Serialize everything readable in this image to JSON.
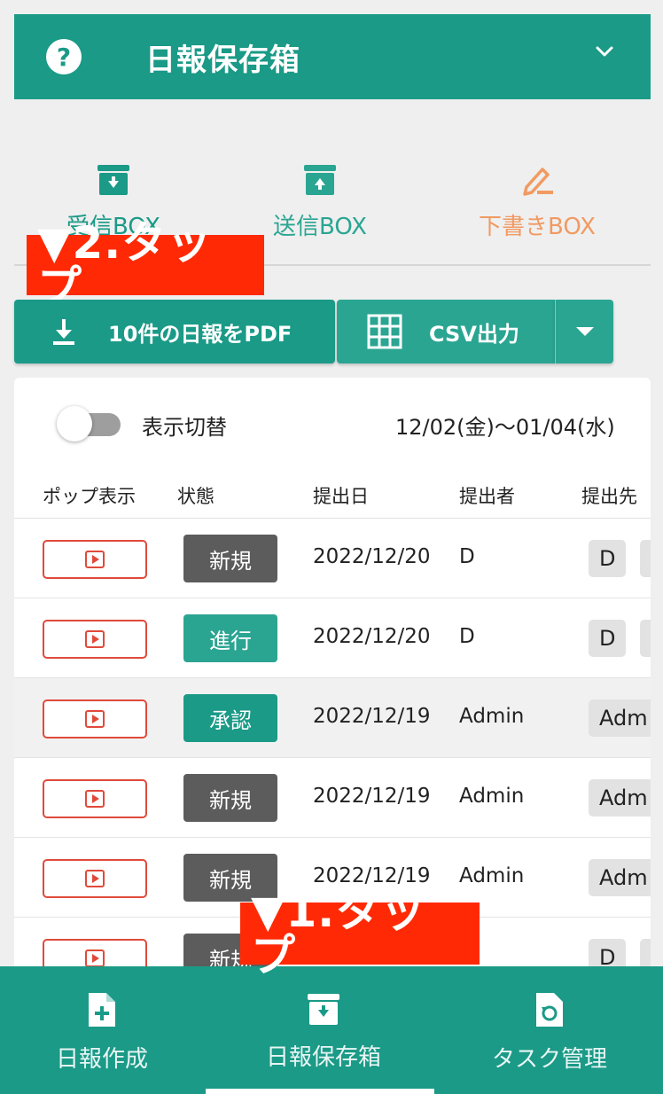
{
  "header": {
    "title": "日報保存箱",
    "help_icon": "question-circle-icon",
    "chevron_icon": "chevron-down-icon"
  },
  "box_tabs": [
    {
      "label": "受信BOX",
      "icon": "inbox-download-icon",
      "color": "#1a9a87"
    },
    {
      "label": "送信BOX",
      "icon": "inbox-upload-icon",
      "color": "#2aa592"
    },
    {
      "label": "下書きBOX",
      "icon": "pencil-icon",
      "color": "#f19a62"
    }
  ],
  "annotations": {
    "step2": "▼2.タップ",
    "step1": "▼1.タップ"
  },
  "actions": {
    "pdf_label": "10件の日報をPDF",
    "csv_label": "CSV出力"
  },
  "filter": {
    "toggle_label": "表示切替",
    "date_range": "12/02(金)〜01/04(水)"
  },
  "columns": [
    "ポップ表示",
    "状態",
    "提出日",
    "提出者",
    "提出先"
  ],
  "rows": [
    {
      "status": "新規",
      "status_color": "#5c5c5c",
      "date": "2022/12/20",
      "submitter": "D",
      "recipient": "D"
    },
    {
      "status": "進行",
      "status_color": "#2aa592",
      "date": "2022/12/20",
      "submitter": "D",
      "recipient": "D"
    },
    {
      "status": "承認",
      "status_color": "#1a9a87",
      "date": "2022/12/19",
      "submitter": "Admin",
      "recipient": "Adm"
    },
    {
      "status": "新規",
      "status_color": "#5c5c5c",
      "date": "2022/12/19",
      "submitter": "Admin",
      "recipient": "Adm"
    },
    {
      "status": "新規",
      "status_color": "#5c5c5c",
      "date": "2022/12/19",
      "submitter": "Admin",
      "recipient": "Adm"
    },
    {
      "status": "新規",
      "status_color": "#5c5c5c",
      "date": "",
      "submitter": "",
      "recipient": "D"
    }
  ],
  "bottom_nav": [
    {
      "label": "日報作成",
      "icon": "file-plus-icon"
    },
    {
      "label": "日報保存箱",
      "icon": "archive-box-icon",
      "active": true
    },
    {
      "label": "タスク管理",
      "icon": "file-refresh-icon"
    }
  ],
  "colors": {
    "primary": "#1a9a87",
    "secondary": "#2aa592",
    "draft": "#f19a62",
    "annotation": "#ff2a05",
    "pop_border": "#e04a3a"
  }
}
